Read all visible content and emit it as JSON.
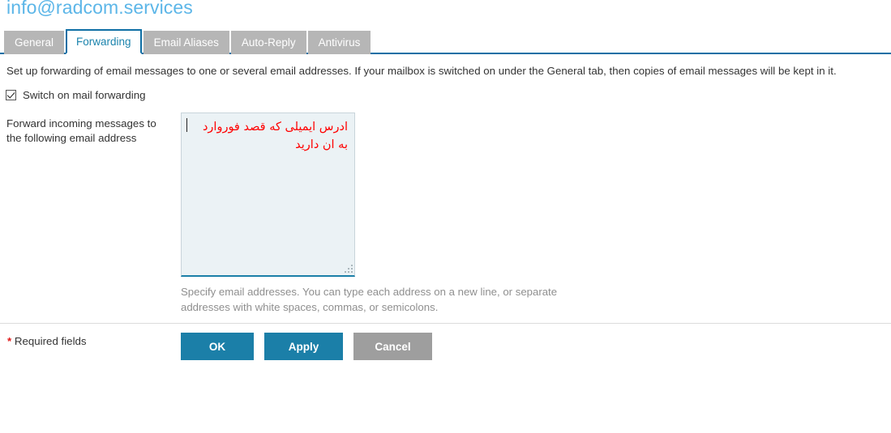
{
  "header": {
    "title": "info@radcom.services",
    "title_color": "#5cb6e8"
  },
  "tabs": {
    "active_index": 1,
    "items": [
      {
        "label": "General"
      },
      {
        "label": "Forwarding"
      },
      {
        "label": "Email Aliases"
      },
      {
        "label": "Auto-Reply"
      },
      {
        "label": "Antivirus"
      }
    ],
    "active_color": "#1c84ad",
    "inactive_bg": "#b6b6b6",
    "underline_color": "#0f6fa5"
  },
  "main": {
    "description": "Set up forwarding of email messages to one or several email addresses. If your mailbox is switched on under the General tab, then copies of email messages will be kept in it.",
    "switch_checkbox": {
      "label": "Switch on mail forwarding",
      "checked": "true"
    },
    "forward_field": {
      "label": "Forward incoming messages to the following email address",
      "value_line1": "ادرس ایمیلی که قصد فوروارد",
      "value_line2": "به ان دارید",
      "value_color": "#ff0000",
      "background": "#ebf2f5",
      "placeholder": "",
      "hint": "Specify email addresses. You can type each address on a new line, or separate addresses with white spaces, commas, or semicolons."
    }
  },
  "footer": {
    "required_star": "*",
    "required_text": " Required fields",
    "ok_label": "OK",
    "apply_label": "Apply",
    "cancel_label": "Cancel",
    "primary_color": "#1b7fa8",
    "cancel_color": "#9e9e9e"
  }
}
